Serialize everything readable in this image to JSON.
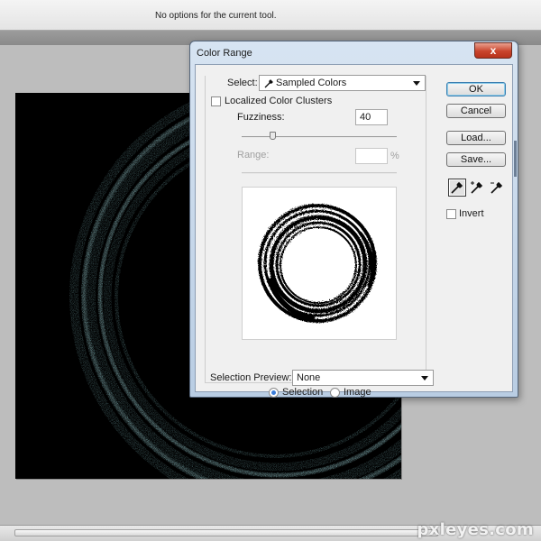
{
  "options_bar": {
    "text": "No options for the current tool."
  },
  "watermark": "pxleyes.com",
  "dialog": {
    "title": "Color Range",
    "close_label": "x",
    "select": {
      "label": "Select:",
      "value": "Sampled Colors"
    },
    "localized_clusters": {
      "label": "Localized Color Clusters",
      "checked": false
    },
    "fuzziness": {
      "label": "Fuzziness:",
      "value": "40",
      "level_percent": 20
    },
    "range": {
      "label": "Range:",
      "value": "",
      "unit": "%"
    },
    "view_mode": {
      "selection_label": "Selection",
      "image_label": "Image",
      "selected": "Selection"
    },
    "selection_preview": {
      "label": "Selection Preview:",
      "value": "None"
    },
    "buttons": {
      "ok": "OK",
      "cancel": "Cancel",
      "load": "Load...",
      "save": "Save..."
    },
    "invert": {
      "label": "Invert",
      "checked": false
    },
    "eyedroppers": [
      "eyedropper-icon",
      "eyedropper-plus-icon",
      "eyedropper-minus-icon"
    ]
  },
  "colors": {
    "ring_glow": "#8fd0d6",
    "canvas_bg": "#000000",
    "dialog_frame": "#c9dbee"
  }
}
